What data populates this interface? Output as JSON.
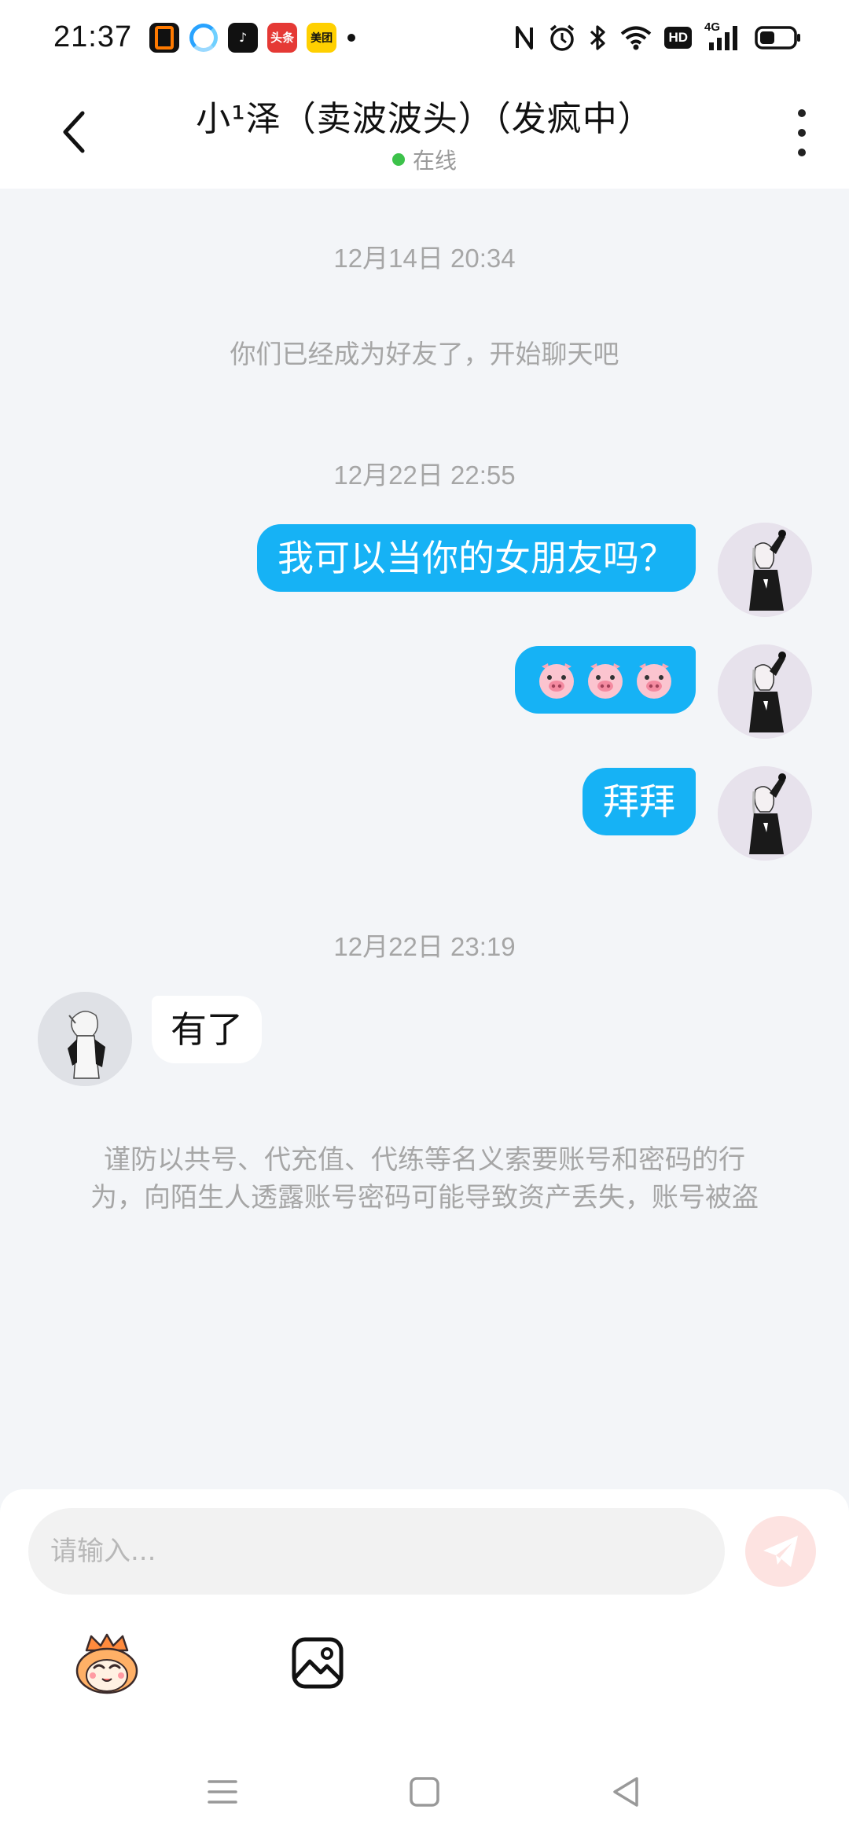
{
  "status_bar": {
    "time": "21:37",
    "apps": [
      {
        "name": "office-icon",
        "label": ""
      },
      {
        "name": "qq-browser-icon",
        "label": ""
      },
      {
        "name": "tiktok-icon",
        "label": "♪"
      },
      {
        "name": "toutiao-icon",
        "label": "头条"
      },
      {
        "name": "meituan-icon",
        "label": "美团"
      }
    ],
    "hd_label": "HD",
    "network_label": "4G",
    "battery_level": 0.45
  },
  "header": {
    "title": "小¹泽（卖波波头）（发疯中）",
    "online_status": "在线",
    "online_color": "#3cc24a"
  },
  "chat": {
    "timestamps": [
      "12月14日 20:34",
      "12月22日 22:55",
      "12月22日 23:19"
    ],
    "system_message": "你们已经成为好友了，开始聊天吧",
    "messages": [
      {
        "from": "me",
        "type": "text",
        "text": "我可以当你的女朋友吗？"
      },
      {
        "from": "me",
        "type": "emoji",
        "emoji": "pig-face",
        "count": 3
      },
      {
        "from": "me",
        "type": "text",
        "text": "拜拜"
      },
      {
        "from": "them",
        "type": "text",
        "text": "有了"
      }
    ],
    "warning_line1": "谨防以共号、代充值、代练等名义索要账号和密码的行",
    "warning_line2": "为，向陌生人透露账号密码可能导致资产丢失，账号被盗",
    "bubble_color": "#16b2f5"
  },
  "input": {
    "placeholder": "请输入..."
  }
}
